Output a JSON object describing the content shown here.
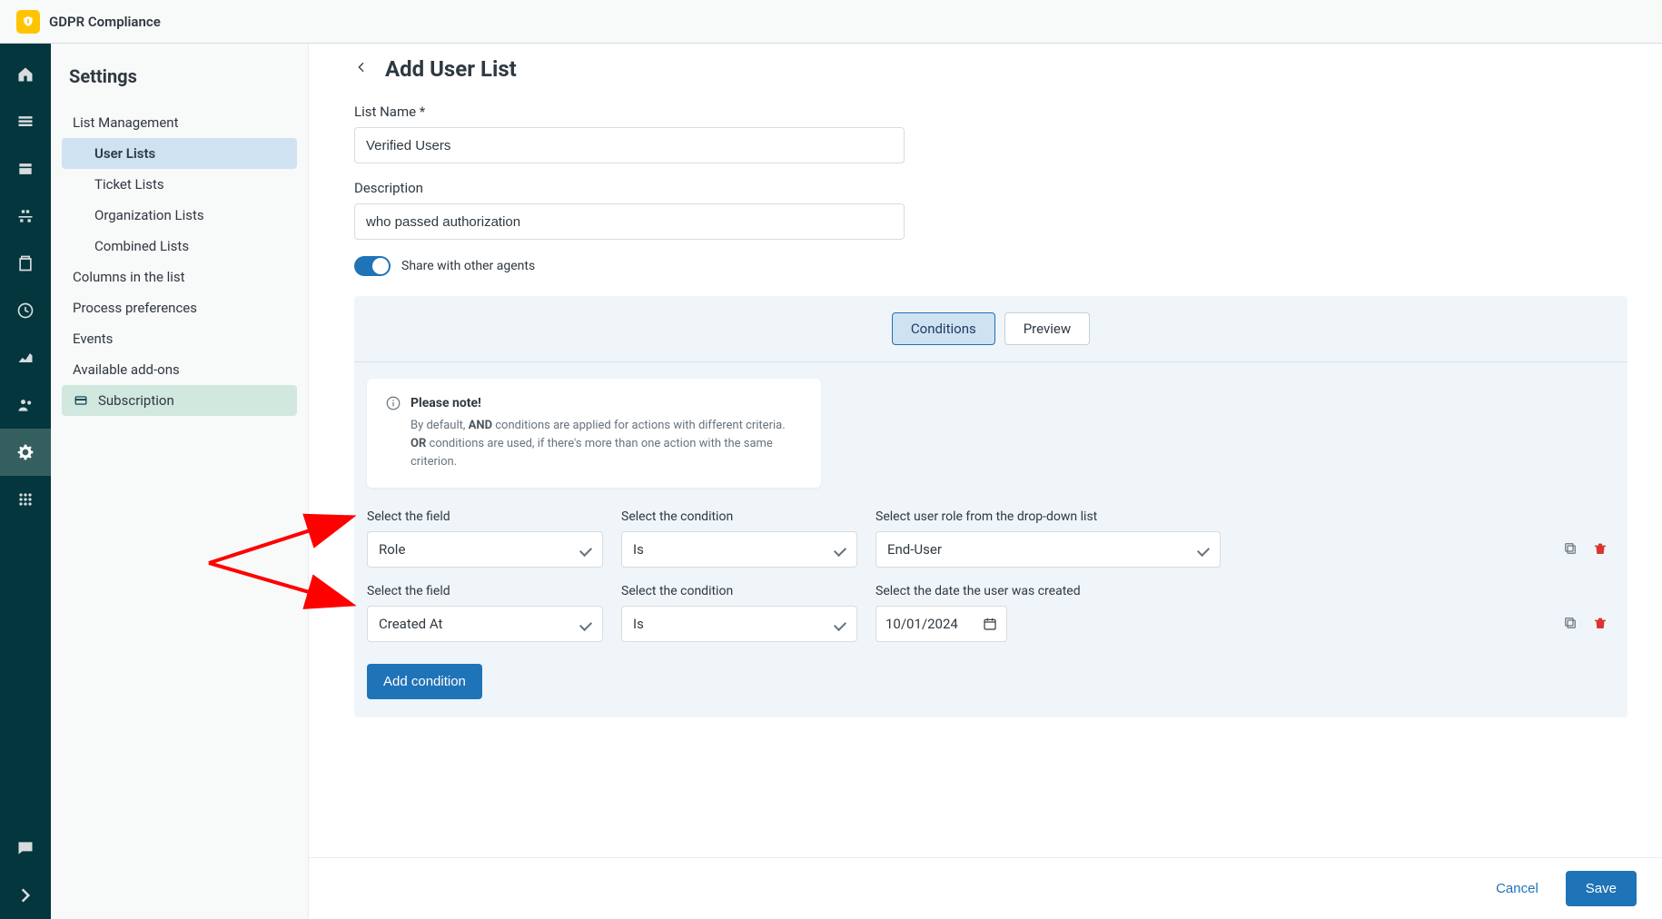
{
  "app_title": "GDPR Compliance",
  "settings_header": "Settings",
  "sidebar": {
    "items": [
      {
        "label": "List Management",
        "children": [
          "User Lists",
          "Ticket Lists",
          "Organization Lists",
          "Combined Lists"
        ],
        "active_child": 0
      },
      {
        "label": "Columns in the list"
      },
      {
        "label": "Process preferences"
      },
      {
        "label": "Events"
      },
      {
        "label": "Available add-ons"
      },
      {
        "label": "Subscription",
        "highlighted": true
      }
    ]
  },
  "page_title": "Add User List",
  "form": {
    "list_name_label": "List Name *",
    "list_name_value": "Verified Users",
    "description_label": "Description",
    "description_value": "who passed authorization",
    "share_label": "Share with other agents",
    "share_on": true
  },
  "tabs": {
    "conditions": "Conditions",
    "preview": "Preview"
  },
  "notice": {
    "title": "Please note!",
    "line1_pre": "By default, ",
    "line1_bold": "AND",
    "line1_post": " conditions are applied for actions with different criteria.",
    "line2_bold": "OR",
    "line2_post": " conditions are used, if there's more than one action with the same criterion."
  },
  "condition_labels": {
    "select_field": "Select the field",
    "select_condition": "Select the condition",
    "select_role": "Select user role from the drop-down list",
    "select_date": "Select the date the user was created"
  },
  "conditions": [
    {
      "field": "Role",
      "op": "Is",
      "value": "End-User",
      "value_type": "dropdown"
    },
    {
      "field": "Created At",
      "op": "Is",
      "value": "10/01/2024",
      "value_type": "date"
    }
  ],
  "buttons": {
    "add_condition": "Add condition",
    "cancel": "Cancel",
    "save": "Save"
  },
  "colors": {
    "primary": "#1f73b7",
    "rail": "#03363d",
    "danger": "#d9362f",
    "highlight_tab": "#cee2f2",
    "highlight_sub": "#d1e8df"
  }
}
